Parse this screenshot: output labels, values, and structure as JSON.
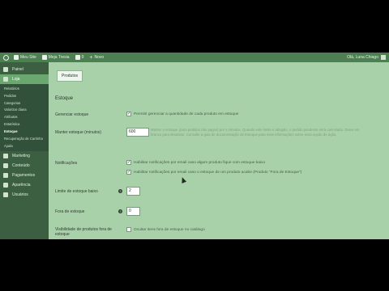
{
  "admin_bar": {
    "site_name": "Meu Site",
    "store_name": "Meja Tresia",
    "comments_count": "0",
    "new_label": "Novo",
    "greeting": "Olá, Luna Chiago"
  },
  "sidebar": {
    "items_top": [
      {
        "label": "Painel",
        "icon": "dashboard-icon"
      }
    ],
    "active_item": {
      "label": "Loja",
      "icon": "store-icon"
    },
    "submenu": [
      {
        "label": "Relatórios"
      },
      {
        "label": "Pedidos"
      },
      {
        "label": "Categorias"
      },
      {
        "label": "Valorizar diana"
      },
      {
        "label": "Atributos"
      },
      {
        "label": "Estatística"
      },
      {
        "label": "Estoque",
        "current": true
      },
      {
        "label": "Recuperação de Carrinho"
      },
      {
        "label": "Ajuda"
      }
    ],
    "items_bottom": [
      {
        "label": "Marketing",
        "icon": "megaphone-icon"
      },
      {
        "label": "Conteúdo",
        "icon": "content-icon"
      },
      {
        "label": "Pagamentos",
        "icon": "payments-icon"
      },
      {
        "label": "Aparência",
        "icon": "appearance-icon"
      },
      {
        "label": "Usuários",
        "icon": "users-icon"
      }
    ]
  },
  "content": {
    "tab_button": "Produtos",
    "section_title": "Estoque",
    "manage_stock": {
      "label": "Gerenciar estoque",
      "checkbox_label": "Permitir gerenciar a quantidade de cada produto em estoque",
      "checked": true
    },
    "hold_stock": {
      "label": "Manter estoque (minutos)",
      "value": "600",
      "description": "Manter o estoque (para pedidos não pagos) por x minutos. Quando este limite é atingido, o pedido pendente será cancelado. Deixe em branco para desativar. Consulte a guia de documentação de Estoque para mais informações sobre essa opção de ação."
    },
    "notifications": {
      "label": "Notificações",
      "options": [
        {
          "label": "Habilitar notificações por email caso algum produto fique com estoque baixo",
          "checked": true
        },
        {
          "label": "Habilitar notificações por email caso o estoque de um produto acabe (Produto \"Fora de Estoque\")",
          "checked": true
        }
      ]
    },
    "low_stock_threshold": {
      "label": "Limite de estoque baixo",
      "value": "2"
    },
    "out_of_stock_threshold": {
      "label": "Fora de estoque",
      "value": "0"
    },
    "out_of_stock_visibility": {
      "label": "Visibilidade de produtos fora de estoque",
      "checkbox_label": "Ocultar itens fora de estoque no catálogo",
      "checked": false
    }
  },
  "colors": {
    "background": "#a9d1a9",
    "admin_bar": "#4d7f52",
    "sidebar": "#3c5f41",
    "active_menu": "#6aa86f"
  }
}
